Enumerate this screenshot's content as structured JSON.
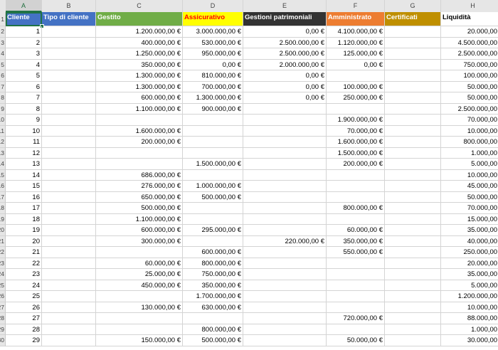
{
  "columns": [
    "A",
    "B",
    "C",
    "D",
    "E",
    "F",
    "G",
    "H"
  ],
  "headers": [
    {
      "text": "Cliente",
      "bg": "#4472c4",
      "fg": "#ffffff"
    },
    {
      "text": "Tipo di cliente",
      "bg": "#4472c4",
      "fg": "#ffffff"
    },
    {
      "text": "Gestito",
      "bg": "#70ad47",
      "fg": "#ffffff"
    },
    {
      "text": "Assicurativo",
      "bg": "#ffff00",
      "fg": "#ff0000"
    },
    {
      "text": "Gestioni patrimoniali",
      "bg": "#333333",
      "fg": "#ffffff"
    },
    {
      "text": "Amministrato",
      "bg": "#ed7d31",
      "fg": "#ffffff"
    },
    {
      "text": "Certificati",
      "bg": "#bf8f00",
      "fg": "#ffffff"
    },
    {
      "text": "Liquidità",
      "bg": "#ffffff",
      "fg": "#000000"
    }
  ],
  "row_numbers": [
    "1",
    "2",
    "3",
    "4",
    "5",
    "6",
    "7",
    "8",
    "9",
    "10",
    "11",
    "12",
    "13",
    "14",
    "15",
    "16",
    "17",
    "18",
    "19",
    "20",
    "21",
    "22",
    "23",
    "24",
    "25",
    "26",
    "27",
    "28",
    "29",
    "30"
  ],
  "rows": [
    [
      "1",
      "",
      "1.200.000,00 €",
      "3.000.000,00 €",
      "0,00 €",
      "4.100.000,00 €",
      "",
      "20.000,00 €"
    ],
    [
      "2",
      "",
      "400.000,00 €",
      "530.000,00 €",
      "2.500.000,00 €",
      "1.120.000,00 €",
      "",
      "4.500.000,00 €"
    ],
    [
      "3",
      "",
      "1.250.000,00 €",
      "950.000,00 €",
      "2.500.000,00 €",
      "125.000,00 €",
      "",
      "2.500.000,00 €"
    ],
    [
      "4",
      "",
      "350.000,00 €",
      "0,00 €",
      "2.000.000,00 €",
      "0,00 €",
      "",
      "750.000,00 €"
    ],
    [
      "5",
      "",
      "1.300.000,00 €",
      "810.000,00 €",
      "0,00 €",
      "",
      "",
      "100.000,00 €"
    ],
    [
      "6",
      "",
      "1.300.000,00 €",
      "700.000,00 €",
      "0,00 €",
      "100.000,00 €",
      "",
      "50.000,00 €"
    ],
    [
      "7",
      "",
      "600.000,00 €",
      "1.300.000,00 €",
      "0,00 €",
      "250.000,00 €",
      "",
      "50.000,00 €"
    ],
    [
      "8",
      "",
      "1.100.000,00 €",
      "900.000,00 €",
      "",
      "",
      "",
      "2.500.000,00 €"
    ],
    [
      "9",
      "",
      "",
      "",
      "",
      "1.900.000,00 €",
      "",
      "70.000,00 €"
    ],
    [
      "10",
      "",
      "1.600.000,00 €",
      "",
      "",
      "70.000,00 €",
      "",
      "10.000,00 €"
    ],
    [
      "11",
      "",
      "200.000,00 €",
      "",
      "",
      "1.600.000,00 €",
      "",
      "800.000,00 €"
    ],
    [
      "12",
      "",
      "",
      "",
      "",
      "1.500.000,00 €",
      "",
      "1.000,00 €"
    ],
    [
      "13",
      "",
      "",
      "1.500.000,00 €",
      "",
      "200.000,00 €",
      "",
      "5.000,00 €"
    ],
    [
      "14",
      "",
      "686.000,00 €",
      "",
      "",
      "",
      "",
      "10.000,00 €"
    ],
    [
      "15",
      "",
      "276.000,00 €",
      "1.000.000,00 €",
      "",
      "",
      "",
      "45.000,00 €"
    ],
    [
      "16",
      "",
      "650.000,00 €",
      "500.000,00 €",
      "",
      "",
      "",
      "50.000,00 €"
    ],
    [
      "17",
      "",
      "500.000,00 €",
      "",
      "",
      "800.000,00 €",
      "",
      "70.000,00 €"
    ],
    [
      "18",
      "",
      "1.100.000,00 €",
      "",
      "",
      "",
      "",
      "15.000,00 €"
    ],
    [
      "19",
      "",
      "600.000,00 €",
      "295.000,00 €",
      "",
      "60.000,00 €",
      "",
      "35.000,00 €"
    ],
    [
      "20",
      "",
      "300.000,00 €",
      "",
      "220.000,00 €",
      "350.000,00 €",
      "",
      "40.000,00 €"
    ],
    [
      "21",
      "",
      "",
      "600.000,00 €",
      "",
      "550.000,00 €",
      "",
      "250.000,00 €"
    ],
    [
      "22",
      "",
      "60.000,00 €",
      "800.000,00 €",
      "",
      "",
      "",
      "20.000,00 €"
    ],
    [
      "23",
      "",
      "25.000,00 €",
      "750.000,00 €",
      "",
      "",
      "",
      "35.000,00 €"
    ],
    [
      "24",
      "",
      "450.000,00 €",
      "350.000,00 €",
      "",
      "",
      "",
      "5.000,00 €"
    ],
    [
      "25",
      "",
      "",
      "1.700.000,00 €",
      "",
      "",
      "",
      "1.200.000,00 €"
    ],
    [
      "26",
      "",
      "130.000,00 €",
      "630.000,00 €",
      "",
      "",
      "",
      "10.000,00 €"
    ],
    [
      "27",
      "",
      "",
      "",
      "",
      "720.000,00 €",
      "",
      "88.000,00 €"
    ],
    [
      "28",
      "",
      "",
      "800.000,00 €",
      "",
      "",
      "",
      "1.000,00 €"
    ],
    [
      "29",
      "",
      "150.000,00 €",
      "500.000,00 €",
      "",
      "50.000,00 €",
      "",
      "30.000,00 €"
    ]
  ]
}
